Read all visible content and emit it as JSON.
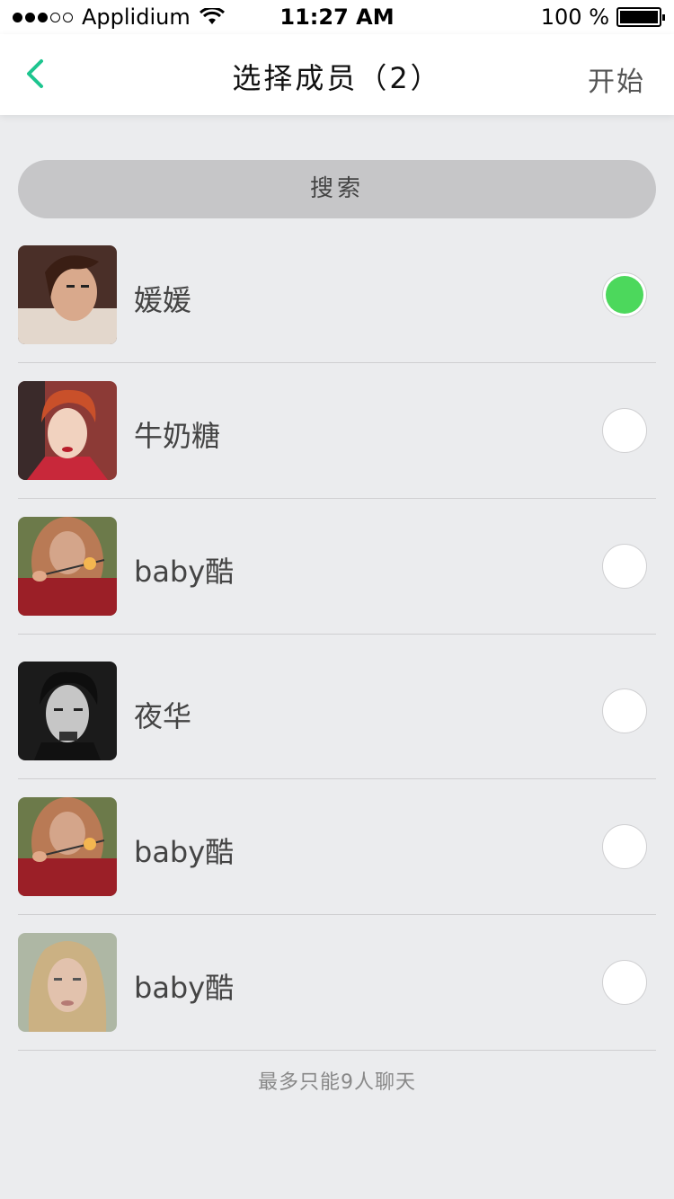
{
  "status_bar": {
    "carrier": "Applidium",
    "time": "11:27 AM",
    "battery_text": "100 %",
    "signal_bars_on": 3,
    "signal_bars_total": 5
  },
  "nav": {
    "title": "选择成员（2）",
    "start_label": "开始",
    "accent_color": "#1dc58f"
  },
  "search": {
    "label": "搜索"
  },
  "members": [
    {
      "name": "媛媛",
      "selected": true,
      "avatar": "woman-short-brown-hair-avatar"
    },
    {
      "name": "牛奶糖",
      "selected": false,
      "avatar": "woman-red-hair-avatar"
    },
    {
      "name": "baby酷",
      "selected": false,
      "avatar": "sparkler-girl-avatar"
    },
    {
      "name": "夜华",
      "selected": false,
      "avatar": "man-black-white-avatar"
    },
    {
      "name": "baby酷",
      "selected": false,
      "avatar": "sparkler-girl-avatar"
    },
    {
      "name": "baby酷",
      "selected": false,
      "avatar": "blonde-woman-avatar"
    }
  ],
  "footer": {
    "note": "最多只能9人聊天"
  },
  "colors": {
    "selected": "#4cd85c",
    "background": "#ebecee"
  }
}
